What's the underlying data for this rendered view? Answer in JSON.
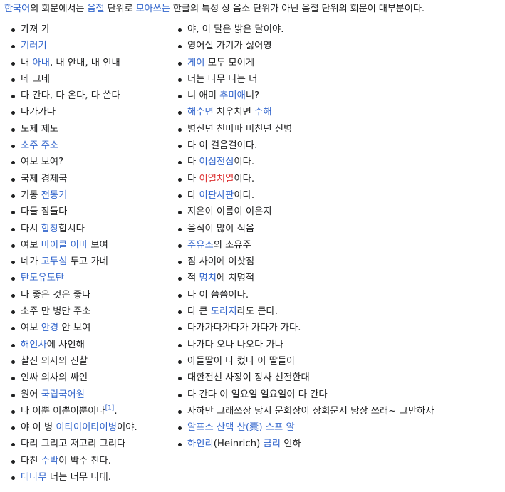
{
  "intro": [
    {
      "t": "한국어",
      "link": true
    },
    {
      "t": "의 회문에서는 "
    },
    {
      "t": "음절",
      "link": true
    },
    {
      "t": " 단위로 "
    },
    {
      "t": "모아쓰는",
      "link": true
    },
    {
      "t": " 한글의 특성 상 음소 단위가 아닌 음절 단위의 회문이 대부분이다."
    }
  ],
  "left_items": [
    [
      {
        "t": "가져 가"
      }
    ],
    [
      {
        "t": "기러기",
        "link": true
      }
    ],
    [
      {
        "t": "내 "
      },
      {
        "t": "아내",
        "link": true
      },
      {
        "t": ", 내 안내, 내 인내"
      }
    ],
    [
      {
        "t": "네 그네"
      }
    ],
    [
      {
        "t": "다 간다, 다 온다, 다 쓴다"
      }
    ],
    [
      {
        "t": "다가가다"
      }
    ],
    [
      {
        "t": "도제 제도"
      }
    ],
    [
      {
        "t": "소주 주소",
        "link": true
      }
    ],
    [
      {
        "t": "여보 보여?"
      }
    ],
    [
      {
        "t": "국제 경제국"
      }
    ],
    [
      {
        "t": "기동 "
      },
      {
        "t": "전동기",
        "link": true
      }
    ],
    [
      {
        "t": "다들 잠들다"
      }
    ],
    [
      {
        "t": "다시 "
      },
      {
        "t": "합창",
        "link": true
      },
      {
        "t": "합시다"
      }
    ],
    [
      {
        "t": "여보 "
      },
      {
        "t": "마이클 이마",
        "link": true
      },
      {
        "t": " 보여"
      }
    ],
    [
      {
        "t": "네가 "
      },
      {
        "t": "고두심",
        "link": true
      },
      {
        "t": " 두고 가네"
      }
    ],
    [
      {
        "t": "탄도유도탄",
        "link": true
      }
    ],
    [
      {
        "t": "다 좋은 것은 좋다"
      }
    ],
    [
      {
        "t": "소주 만 병만 주소"
      }
    ],
    [
      {
        "t": "여보 "
      },
      {
        "t": "안경",
        "link": true
      },
      {
        "t": " 안 보여"
      }
    ],
    [
      {
        "t": "해인사",
        "link": true
      },
      {
        "t": "에 사인해"
      }
    ],
    [
      {
        "t": "찰진 의사의 진찰"
      }
    ],
    [
      {
        "t": "인싸 의사의 싸인"
      }
    ],
    [
      {
        "t": "원어 "
      },
      {
        "t": "국립국어원",
        "link": true
      }
    ],
    [
      {
        "t": "다 이뿐 이뿐이뿐이다"
      },
      {
        "t": "[1]",
        "sup": true,
        "link": true
      },
      {
        "t": "."
      }
    ],
    [
      {
        "t": "야 이 병 "
      },
      {
        "t": "이타이이타이병",
        "link": true
      },
      {
        "t": "이야."
      }
    ],
    [
      {
        "t": "다리 그리고 저고리 그리다"
      }
    ],
    [
      {
        "t": "다친 "
      },
      {
        "t": "수박",
        "link": true
      },
      {
        "t": "이 박수 친다."
      }
    ],
    [
      {
        "t": "대나무",
        "link": true
      },
      {
        "t": " 너는 너무 나대."
      }
    ]
  ],
  "right_items": [
    [
      {
        "t": "야, 이 달은 밝은 달이야."
      }
    ],
    [
      {
        "t": "영어실 가기가 싫어영"
      }
    ],
    [
      {
        "t": "게이",
        "link": true
      },
      {
        "t": " 모두 모이게"
      }
    ],
    [
      {
        "t": "너는 나무 나는 너"
      }
    ],
    [
      {
        "t": "니 애미 "
      },
      {
        "t": "추미애",
        "link": true
      },
      {
        "t": "니?"
      }
    ],
    [
      {
        "t": "해수면",
        "link": true
      },
      {
        "t": " 치우치면 "
      },
      {
        "t": "수해",
        "link": true
      }
    ],
    [
      {
        "t": "병신년 친미파 미친년 신병"
      }
    ],
    [
      {
        "t": "다 이 걸음걸이다."
      }
    ],
    [
      {
        "t": "다 "
      },
      {
        "t": "이심전심",
        "link": true
      },
      {
        "t": "이다."
      }
    ],
    [
      {
        "t": "다 "
      },
      {
        "t": "이열치열",
        "link": true,
        "red": true
      },
      {
        "t": "이다."
      }
    ],
    [
      {
        "t": "다 "
      },
      {
        "t": "이판사판",
        "link": true
      },
      {
        "t": "이다."
      }
    ],
    [
      {
        "t": "지은이 이름이 이은지"
      }
    ],
    [
      {
        "t": "음식이 많이 식음"
      }
    ],
    [
      {
        "t": "주유소",
        "link": true
      },
      {
        "t": "의 소유주"
      }
    ],
    [
      {
        "t": "짐 사이에 이삿짐"
      }
    ],
    [
      {
        "t": "적 "
      },
      {
        "t": "명치",
        "link": true
      },
      {
        "t": "에 치명적"
      }
    ],
    [
      {
        "t": "다 이 씀씀이다."
      }
    ],
    [
      {
        "t": "다 큰 "
      },
      {
        "t": "도라지",
        "link": true
      },
      {
        "t": "라도 큰다."
      }
    ],
    [
      {
        "t": "다가가다가다가 가다가 가다."
      }
    ],
    [
      {
        "t": "나가다 오나 나오다 가나"
      }
    ],
    [
      {
        "t": "아들딸이 다 컸다 이 딸들아"
      }
    ],
    [
      {
        "t": "대한전선 사장이 장사 선전한대"
      }
    ],
    [
      {
        "t": "다 간다 이 일요일 일요일이 다 간다"
      }
    ],
    [
      {
        "t": "자하만 그래쓰장 당시 문회장이 장회문시 당장 쓰래~ 그만하자"
      }
    ],
    [
      {
        "t": "알프스 산맥",
        "link": true
      },
      {
        "t": " 산(橐) 스프 알",
        "link": true
      }
    ],
    [
      {
        "t": "하인리",
        "link": true
      },
      {
        "t": "(Heinrich) "
      },
      {
        "t": "금리",
        "link": true
      },
      {
        "t": " 인하"
      }
    ]
  ]
}
